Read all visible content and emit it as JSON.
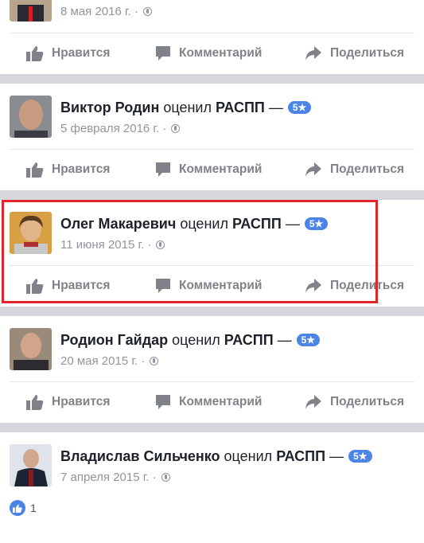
{
  "actions": {
    "like": "Нравится",
    "comment": "Комментарий",
    "share": "Поделиться"
  },
  "posts": [
    {
      "name": "",
      "verb": "",
      "page": "",
      "badge": "",
      "date": "8 мая 2016 г. ·",
      "avatar_icon": "person-avatar-icon"
    },
    {
      "name": "Виктор Родин",
      "verb": " оценил ",
      "page": "РАСПП",
      "dash": " —",
      "badge": "5★",
      "date": "5 февраля 2016 г. ·",
      "avatar_icon": "person-avatar-icon"
    },
    {
      "name": "Олег Макаревич",
      "verb": " оценил ",
      "page": "РАСПП",
      "dash": " —",
      "badge": "5★",
      "date": "11 июня 2015 г. ·",
      "avatar_icon": "person-avatar-icon"
    },
    {
      "name": "Родион Гайдар",
      "verb": " оценил ",
      "page": "РАСПП",
      "dash": " —",
      "badge": "5★",
      "date": "20 мая 2015 г. ·",
      "avatar_icon": "person-avatar-icon"
    },
    {
      "name": "Владислав Сильченко",
      "verb": " оценил ",
      "page": "РАСПП",
      "dash": " —",
      "badge": "5★",
      "date": "7 апреля 2015 г. ·",
      "avatar_icon": "person-avatar-icon",
      "likes": "1"
    }
  ],
  "colors": {
    "highlight": "#e0262b",
    "badge": "#4a84e6",
    "separator": "#d5d7dc"
  }
}
